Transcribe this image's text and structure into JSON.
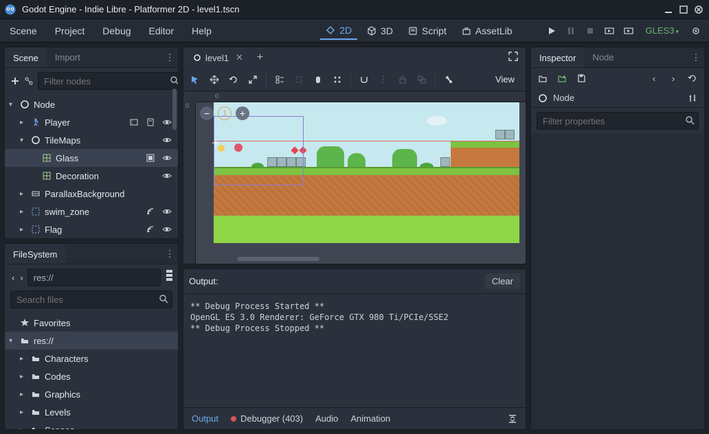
{
  "title": "Godot Engine - Indie Libre - Platformer 2D - level1.tscn",
  "menu": {
    "items": [
      "Scene",
      "Project",
      "Debug",
      "Editor",
      "Help"
    ]
  },
  "center_tabs": [
    {
      "label": "2D",
      "active": true
    },
    {
      "label": "3D",
      "active": false
    },
    {
      "label": "Script",
      "active": false
    },
    {
      "label": "AssetLib",
      "active": false
    }
  ],
  "renderer": "GLES3",
  "scene_panel": {
    "tabs": [
      {
        "label": "Scene",
        "active": true
      },
      {
        "label": "Import",
        "active": false
      }
    ],
    "filter_placeholder": "Filter nodes",
    "tree": [
      {
        "label": "Node",
        "depth": 0,
        "arrow": "▾",
        "icon": "circle",
        "right": []
      },
      {
        "label": "Player",
        "depth": 1,
        "arrow": "▸",
        "icon": "run",
        "right": [
          "scene",
          "script",
          "eye"
        ]
      },
      {
        "label": "TileMaps",
        "depth": 1,
        "arrow": "▾",
        "icon": "circle",
        "right": [
          "eye"
        ]
      },
      {
        "label": "Glass",
        "depth": 2,
        "arrow": "",
        "icon": "grid",
        "right": [
          "focus",
          "eye"
        ],
        "selected": true
      },
      {
        "label": "Decoration",
        "depth": 2,
        "arrow": "",
        "icon": "grid",
        "right": [
          "eye"
        ]
      },
      {
        "label": "ParallaxBackground",
        "depth": 1,
        "arrow": "▸",
        "icon": "parallax",
        "right": []
      },
      {
        "label": "swim_zone",
        "depth": 1,
        "arrow": "▸",
        "icon": "area",
        "right": [
          "signal",
          "eye"
        ]
      },
      {
        "label": "Flag",
        "depth": 1,
        "arrow": "▸",
        "icon": "area",
        "right": [
          "signal",
          "eye"
        ]
      }
    ]
  },
  "filesystem": {
    "label": "FileSystem",
    "path": "res://",
    "search_placeholder": "Search files",
    "tree": [
      {
        "label": "Favorites",
        "depth": 0,
        "arrow": "",
        "icon": "star"
      },
      {
        "label": "res://",
        "depth": 0,
        "arrow": "▾",
        "icon": "folder",
        "selected": true
      },
      {
        "label": "Characters",
        "depth": 1,
        "arrow": "▸",
        "icon": "folder"
      },
      {
        "label": "Codes",
        "depth": 1,
        "arrow": "▸",
        "icon": "folder"
      },
      {
        "label": "Graphics",
        "depth": 1,
        "arrow": "▸",
        "icon": "folder"
      },
      {
        "label": "Levels",
        "depth": 1,
        "arrow": "▸",
        "icon": "folder"
      },
      {
        "label": "Scenes",
        "depth": 1,
        "arrow": "▸",
        "icon": "folder"
      }
    ]
  },
  "open_scene_tab": "level1",
  "view_label": "View",
  "zoom_level": "1",
  "ruler_zero": "0",
  "output": {
    "label": "Output:",
    "clear": "Clear",
    "lines": "** Debug Process Started **\nOpenGL ES 3.0 Renderer: GeForce GTX 980 Ti/PCIe/SSE2\n** Debug Process Stopped **"
  },
  "bottom_tabs": [
    {
      "label": "Output",
      "active": true
    },
    {
      "label": "Debugger (403)",
      "dot": true
    },
    {
      "label": "Audio"
    },
    {
      "label": "Animation"
    }
  ],
  "inspector": {
    "tabs": [
      {
        "label": "Inspector",
        "active": true
      },
      {
        "label": "Node",
        "active": false
      }
    ],
    "node_label": "Node",
    "filter_placeholder": "Filter properties"
  }
}
